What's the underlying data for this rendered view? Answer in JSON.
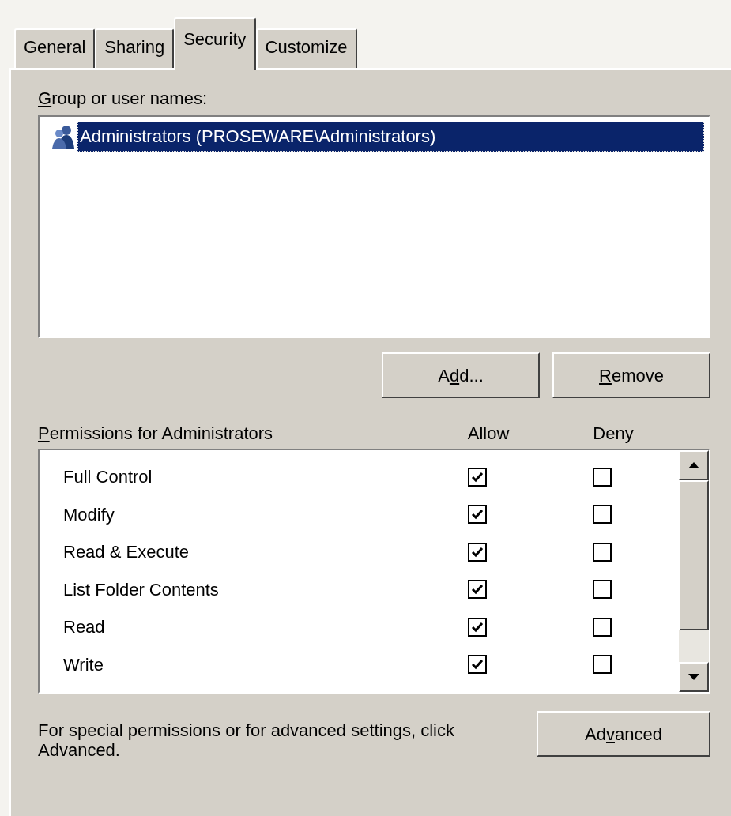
{
  "tabs": [
    {
      "label": "General",
      "selected": false
    },
    {
      "label": "Sharing",
      "selected": false
    },
    {
      "label": "Security",
      "selected": true
    },
    {
      "label": "Customize",
      "selected": false
    }
  ],
  "users": {
    "label": {
      "key": "G",
      "after": "roup or user names:"
    },
    "items": [
      {
        "name": "Administrators (PROSEWARE\\Administrators)",
        "selected": true
      }
    ]
  },
  "user_buttons": [
    {
      "before": "A",
      "key": "d",
      "after": "d..."
    },
    {
      "key": "R",
      "after": "emove"
    }
  ],
  "permissions": {
    "label": {
      "key": "P",
      "after": "ermissions for Administrators"
    },
    "allow_header": "Allow",
    "deny_header": "Deny",
    "rows": [
      {
        "name": "Full Control",
        "allow": true,
        "deny": false
      },
      {
        "name": "Modify",
        "allow": true,
        "deny": false
      },
      {
        "name": "Read & Execute",
        "allow": true,
        "deny": false
      },
      {
        "name": "List Folder Contents",
        "allow": true,
        "deny": false
      },
      {
        "name": "Read",
        "allow": true,
        "deny": false
      },
      {
        "name": "Write",
        "allow": true,
        "deny": false
      }
    ]
  },
  "footer": {
    "text": "For special permissions or for advanced settings, click Advanced.",
    "button": {
      "before": "Ad",
      "key": "v",
      "after": "anced"
    }
  }
}
